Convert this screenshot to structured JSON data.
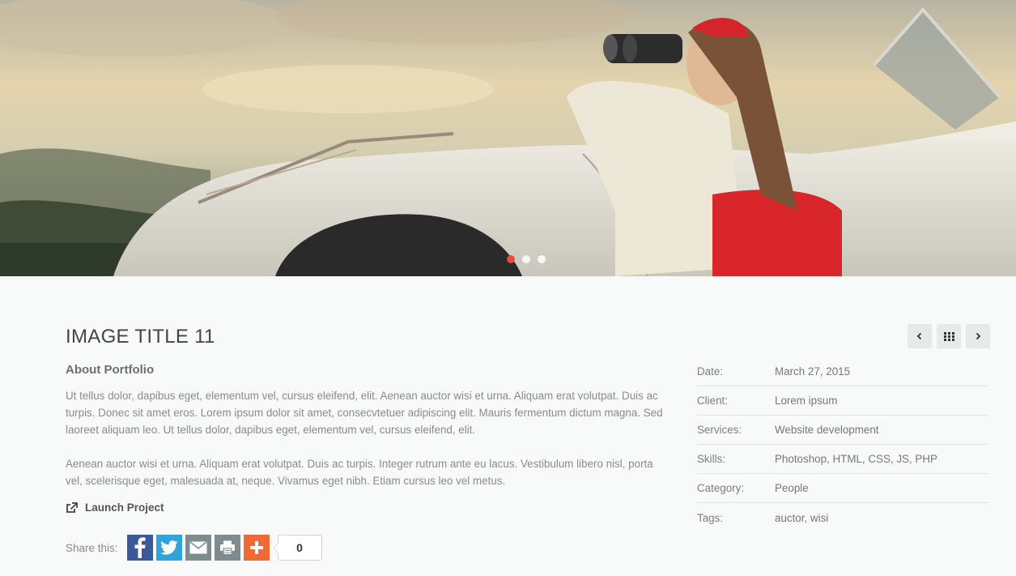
{
  "slider": {
    "dots": 3,
    "active_index": 0,
    "accent": "#e84c3d"
  },
  "project": {
    "title": "IMAGE TITLE 11",
    "about_heading": "About Portfolio",
    "paragraph1": "Ut tellus dolor, dapibus eget, elementum vel, cursus eleifend, elit. Aenean auctor wisi et urna. Aliquam erat volutpat. Duis ac turpis. Donec sit amet eros. Lorem ipsum dolor sit amet, consecvtetuer adipiscing elit. Mauris fermentum dictum magna. Sed laoreet aliquam leo. Ut tellus dolor, dapibus eget, elementum vel, cursus eleifend, elit.",
    "paragraph2": "Aenean auctor wisi et urna. Aliquam erat volutpat. Duis ac turpis. Integer rutrum ante eu lacus. Vestibulum libero nisl, porta vel, scelerisque eget, malesuada at, neque. Vivamus eget nibh. Etiam cursus leo vel metus.",
    "launch_label": "Launch Project"
  },
  "share": {
    "label": "Share this:",
    "buttons": [
      {
        "name": "facebook",
        "icon": "facebook-icon",
        "color": "#3b5998"
      },
      {
        "name": "twitter",
        "icon": "twitter-icon",
        "color": "#2fa4dc"
      },
      {
        "name": "email",
        "icon": "envelope-icon",
        "color": "#7f8c8d"
      },
      {
        "name": "print",
        "icon": "printer-icon",
        "color": "#7f8c8d"
      },
      {
        "name": "more",
        "icon": "plus-icon",
        "color": "#f06a35"
      }
    ],
    "count": "0"
  },
  "meta": {
    "rows": [
      {
        "key": "Date:",
        "value": "March 27, 2015"
      },
      {
        "key": "Client:",
        "value": "Lorem ipsum"
      },
      {
        "key": "Services:",
        "value": "Website development"
      },
      {
        "key": "Skills:",
        "value": "Photoshop, HTML, CSS, JS, PHP"
      },
      {
        "key": "Category:",
        "value": "People"
      },
      {
        "key": "Tags:",
        "value": "auctor, wisi"
      }
    ]
  },
  "nav": {
    "prev_icon": "chevron-left-icon",
    "grid_icon": "grid-icon",
    "next_icon": "chevron-right-icon"
  }
}
